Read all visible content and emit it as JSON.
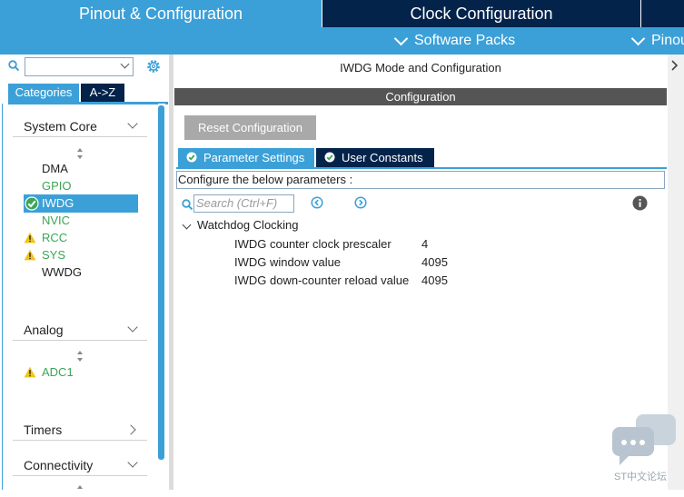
{
  "top_tabs": {
    "pinout": "Pinout & Configuration",
    "clock": "Clock Configuration"
  },
  "subbar": {
    "software_packs": "Software Packs",
    "pinout": "Pinout"
  },
  "left": {
    "search": {
      "value": ""
    },
    "tabs": {
      "categories": "Categories",
      "atoz": "A->Z"
    },
    "sections": {
      "system_core": {
        "label": "System Core",
        "items": [
          {
            "label": "DMA",
            "state": "plain"
          },
          {
            "label": "GPIO",
            "state": "green"
          },
          {
            "label": "IWDG",
            "state": "selected-check"
          },
          {
            "label": "NVIC",
            "state": "green"
          },
          {
            "label": "RCC",
            "state": "warning"
          },
          {
            "label": "SYS",
            "state": "warning"
          },
          {
            "label": "WWDG",
            "state": "plain"
          }
        ]
      },
      "analog": {
        "label": "Analog",
        "items": [
          {
            "label": "ADC1",
            "state": "warning"
          }
        ]
      },
      "timers": {
        "label": "Timers"
      },
      "connectivity": {
        "label": "Connectivity"
      }
    }
  },
  "right": {
    "mode_title": "IWDG Mode and Configuration",
    "config_bar": "Configuration",
    "reset_button": "Reset Configuration",
    "tabs": {
      "parameter_settings": "Parameter Settings",
      "user_constants": "User Constants"
    },
    "configure_hint": "Configure the below parameters :",
    "param_search_placeholder": "Search (Ctrl+F)",
    "group": "Watchdog Clocking",
    "params": [
      {
        "name": "IWDG counter clock prescaler",
        "value": "4"
      },
      {
        "name": "IWDG window value",
        "value": "4095"
      },
      {
        "name": "IWDG down-counter reload value",
        "value": "4095"
      }
    ]
  },
  "watermark": "ST中文论坛",
  "colors": {
    "accent": "#3ca0d8",
    "dark": "#03234b",
    "ok": "#3aa655",
    "warning": "#f0c419"
  }
}
